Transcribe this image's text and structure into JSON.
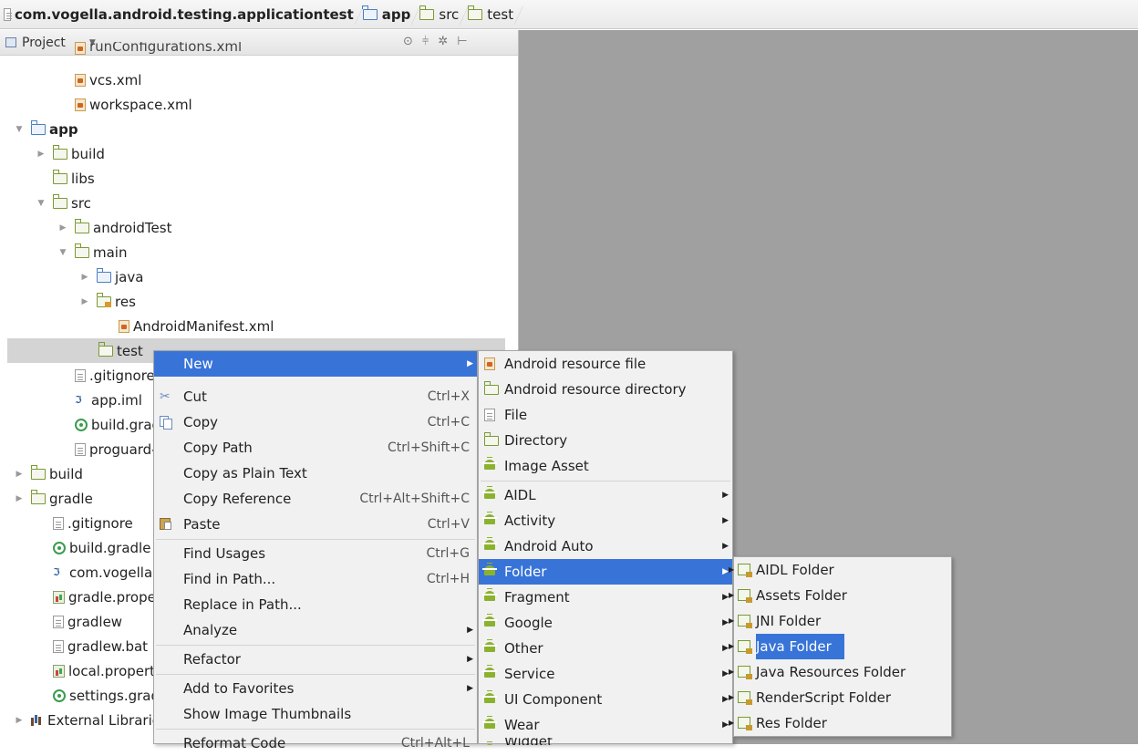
{
  "breadcrumb": [
    {
      "label": "com.vogella.android.testing.applicationtest",
      "bold": true
    },
    {
      "label": "app",
      "bold": true
    },
    {
      "label": "src",
      "bold": false
    },
    {
      "label": "test",
      "bold": false
    }
  ],
  "panel": {
    "title": "Project",
    "tools": [
      "⊙",
      "⫩",
      "✲",
      "⊢"
    ]
  },
  "tree": [
    {
      "label": "runConfigurations.xml"
    },
    {
      "label": "vcs.xml"
    },
    {
      "label": "workspace.xml"
    },
    {
      "label": "app"
    },
    {
      "label": "build"
    },
    {
      "label": "libs"
    },
    {
      "label": "src"
    },
    {
      "label": "androidTest"
    },
    {
      "label": "main"
    },
    {
      "label": "java"
    },
    {
      "label": "res"
    },
    {
      "label": "AndroidManifest.xml"
    },
    {
      "label": "test"
    },
    {
      "label": ".gitignore"
    },
    {
      "label": "app.iml"
    },
    {
      "label": "build.gradle"
    },
    {
      "label": "proguard-rules.pro"
    },
    {
      "label": "build"
    },
    {
      "label": "gradle"
    },
    {
      "label": ".gitignore"
    },
    {
      "label": "build.gradle"
    },
    {
      "label": "com.vogella.android.testing.applicationtest.iml"
    },
    {
      "label": "gradle.properties"
    },
    {
      "label": "gradlew"
    },
    {
      "label": "gradlew.bat"
    },
    {
      "label": "local.properties"
    },
    {
      "label": "settings.gradle"
    },
    {
      "label": "External Libraries"
    }
  ],
  "context_menu": [
    {
      "label": "New",
      "shortcut": ""
    },
    {
      "label": "Cut",
      "shortcut": "Ctrl+X"
    },
    {
      "label": "Copy",
      "shortcut": "Ctrl+C"
    },
    {
      "label": "Copy Path",
      "shortcut": "Ctrl+Shift+C"
    },
    {
      "label": "Copy as Plain Text",
      "shortcut": ""
    },
    {
      "label": "Copy Reference",
      "shortcut": "Ctrl+Alt+Shift+C"
    },
    {
      "label": "Paste",
      "shortcut": "Ctrl+V"
    },
    {
      "label": "Find Usages",
      "shortcut": "Ctrl+G"
    },
    {
      "label": "Find in Path...",
      "shortcut": "Ctrl+H"
    },
    {
      "label": "Replace in Path...",
      "shortcut": ""
    },
    {
      "label": "Analyze",
      "shortcut": ""
    },
    {
      "label": "Refactor",
      "shortcut": ""
    },
    {
      "label": "Add to Favorites",
      "shortcut": ""
    },
    {
      "label": "Show Image Thumbnails",
      "shortcut": ""
    },
    {
      "label": "Reformat Code",
      "shortcut": "Ctrl+Alt+L"
    }
  ],
  "new_menu": [
    {
      "label": "Android resource file"
    },
    {
      "label": "Android resource directory"
    },
    {
      "label": "File"
    },
    {
      "label": "Directory"
    },
    {
      "label": "Image Asset"
    },
    {
      "label": "AIDL"
    },
    {
      "label": "Activity"
    },
    {
      "label": "Android Auto"
    },
    {
      "label": "Folder"
    },
    {
      "label": "Fragment"
    },
    {
      "label": "Google"
    },
    {
      "label": "Other"
    },
    {
      "label": "Service"
    },
    {
      "label": "UI Component"
    },
    {
      "label": "Wear"
    },
    {
      "label": "Widget"
    }
  ],
  "folder_menu": [
    {
      "label": "AIDL Folder"
    },
    {
      "label": "Assets Folder"
    },
    {
      "label": "JNI Folder"
    },
    {
      "label": "Java Folder"
    },
    {
      "label": "Java Resources Folder"
    },
    {
      "label": "RenderScript Folder"
    },
    {
      "label": "Res Folder"
    }
  ],
  "colors": {
    "highlight": "#3874d8",
    "editor_bg": "#a0a0a0",
    "selection": "#d4d4d4"
  }
}
